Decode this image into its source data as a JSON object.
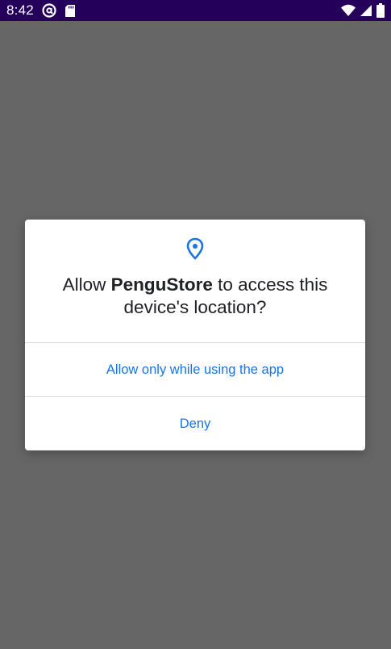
{
  "status_bar": {
    "time": "8:42",
    "icons": [
      "at-sign-icon",
      "sd-card-icon",
      "wifi-icon",
      "signal-icon",
      "battery-icon"
    ]
  },
  "dialog": {
    "icon": "location-pin-icon",
    "title_prefix": "Allow ",
    "app_name": "PenguStore",
    "title_suffix": " to access this device's location?",
    "buttons": {
      "allow_while_using": "Allow only while using the app",
      "deny": "Deny"
    }
  },
  "colors": {
    "status_bar_bg": "#24005a",
    "scrim": "#666666",
    "accent": "#1a73e8"
  }
}
